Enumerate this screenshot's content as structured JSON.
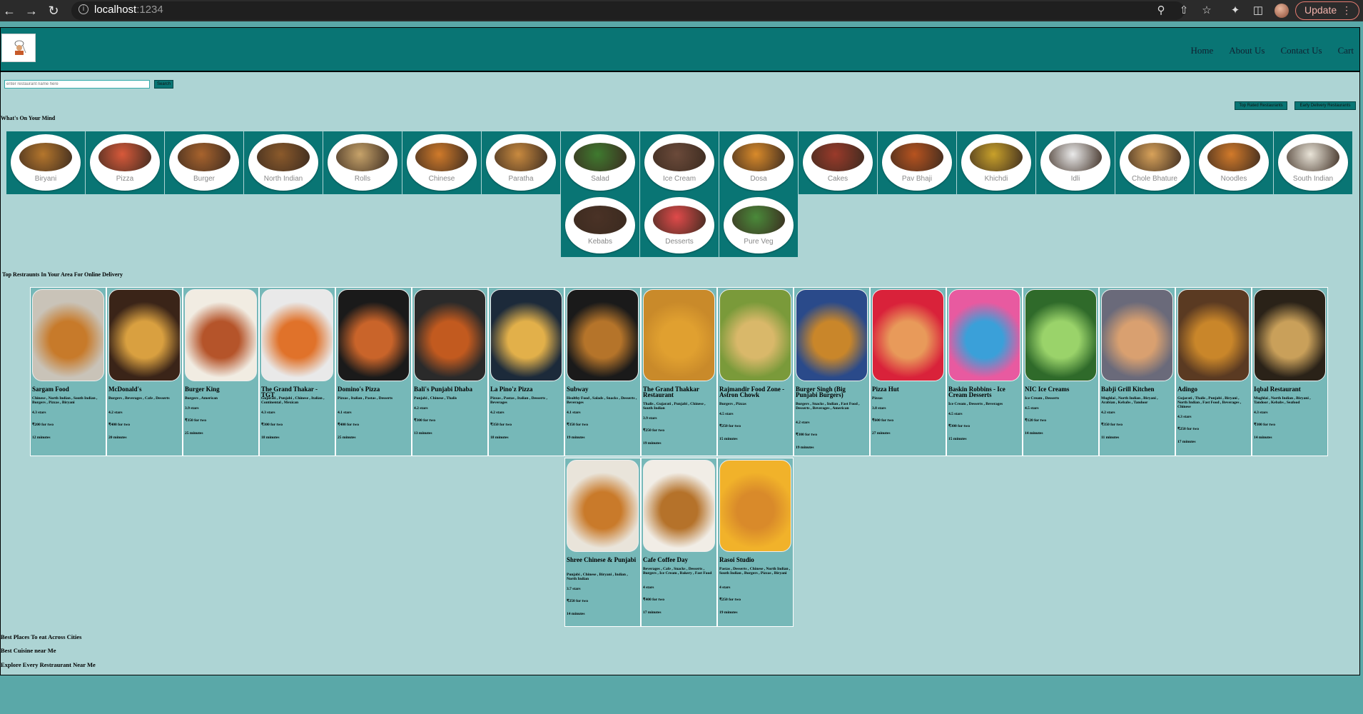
{
  "browser": {
    "url_host": "localhost",
    "url_port": ":1234",
    "update_label": "Update"
  },
  "nav": {
    "links": [
      "Home",
      "About Us",
      "Contact Us",
      "Cart"
    ]
  },
  "search": {
    "placeholder": "enter restaurant name here",
    "button": "Search"
  },
  "filters": [
    "Top Rated Restaurants",
    "Early Delivery Restaurants"
  ],
  "sections": {
    "mind": "What's On Your Mind",
    "top": "Top Restraunts In Your Area For Online Delivery"
  },
  "categories": [
    {
      "name": "Biryani",
      "color": "#b5762c"
    },
    {
      "name": "Pizza",
      "color": "#d8593a"
    },
    {
      "name": "Burger",
      "color": "#a8632d"
    },
    {
      "name": "North Indian",
      "color": "#8b5a2b"
    },
    {
      "name": "Rolls",
      "color": "#c7a36a"
    },
    {
      "name": "Chinese",
      "color": "#d07a2a"
    },
    {
      "name": "Paratha",
      "color": "#c98a3f"
    },
    {
      "name": "Salad",
      "color": "#3f7a2f"
    },
    {
      "name": "Ice Cream",
      "color": "#6b4a3a"
    },
    {
      "name": "Dosa",
      "color": "#d98a2a"
    },
    {
      "name": "Cakes",
      "color": "#9a3a2a"
    },
    {
      "name": "Pav Bhaji",
      "color": "#b7531f"
    },
    {
      "name": "Khichdi",
      "color": "#c9a12a"
    },
    {
      "name": "Idli",
      "color": "#eaeaea"
    },
    {
      "name": "Chole Bhature",
      "color": "#d8a25a"
    },
    {
      "name": "Noodles",
      "color": "#d27a2a"
    },
    {
      "name": "South Indian",
      "color": "#e9e4d8"
    },
    {
      "name": "Kebabs",
      "color": "#4a3226"
    },
    {
      "name": "Desserts",
      "color": "#e04a4a"
    },
    {
      "name": "Pure Veg",
      "color": "#4a8a3a"
    }
  ],
  "restaurants": [
    {
      "name": "Sargam Food",
      "cuisine": "Chinese , North Indian , South Indian , Burgers , Pizzas , Biryani",
      "rating": "4.3 stars",
      "cost": "₹200 for two",
      "time": "12 minutes",
      "bg": "#c9c3b8",
      "accent": "#c77a2a"
    },
    {
      "name": "McDonald's",
      "cuisine": "Burgers , Beverages , Cafe , Desserts",
      "rating": "4.2 stars",
      "cost": "₹400 for two",
      "time": "20 minutes",
      "bg": "#3a2418",
      "accent": "#d9a040"
    },
    {
      "name": "Burger King",
      "cuisine": "Burgers , American",
      "rating": "3.9 stars",
      "cost": "₹350 for two",
      "time": "25 minutes",
      "bg": "#f1ece2",
      "accent": "#b5542a"
    },
    {
      "name": "The Grand Thakar - TGT",
      "cuisine": "Gujarati , Punjabi , Chinese , Italian , Continental , Mexican",
      "rating": "4.3 stars",
      "cost": "₹300 for two",
      "time": "18 minutes",
      "bg": "#e9e9e9",
      "accent": "#e0722a"
    },
    {
      "name": "Domino's Pizza",
      "cuisine": "Pizzas , Italian , Pastas , Desserts",
      "rating": "4.1 stars",
      "cost": "₹400 for two",
      "time": "25 minutes",
      "bg": "#1a1a1a",
      "accent": "#c9642a"
    },
    {
      "name": "Bali's Punjabi Dhaba",
      "cuisine": "Punjabi , Chinese , Thalis",
      "rating": "4.2 stars",
      "cost": "₹300 for two",
      "time": "13 minutes",
      "bg": "#2a2a2a",
      "accent": "#c25a1f"
    },
    {
      "name": "La Pino'z Pizza",
      "cuisine": "Pizzas , Pastas , Italian , Desserts , Beverages",
      "rating": "4.2 stars",
      "cost": "₹350 for two",
      "time": "18 minutes",
      "bg": "#1c2a3a",
      "accent": "#e2b04a"
    },
    {
      "name": "Subway",
      "cuisine": "Healthy Food , Salads , Snacks , Desserts , Beverages",
      "rating": "4.1 stars",
      "cost": "₹350 for two",
      "time": "19 minutes",
      "bg": "#1a1a1a",
      "accent": "#b5742a"
    },
    {
      "name": "The Grand Thakkar Restaurant",
      "cuisine": "Thalis , Gujarati , Punjabi , Chinese , South Indian",
      "rating": "3.9 stars",
      "cost": "₹250 for two",
      "time": "19 minutes",
      "bg": "#c98a2a",
      "accent": "#e0a030"
    },
    {
      "name": "Rajmandir Food Zone - Astron Chowk",
      "cuisine": "Burgers , Pizzas",
      "rating": "4.5 stars",
      "cost": "₹250 for two",
      "time": "15 minutes",
      "bg": "#7a9a3a",
      "accent": "#d9b86a"
    },
    {
      "name": "Burger Singh (Big Punjabi Burgers)",
      "cuisine": "Burgers , Snacks , Indian , Fast Food , Desserts , Beverages , American",
      "rating": "4.2 stars",
      "cost": "₹300 for two",
      "time": "19 minutes",
      "bg": "#2a4a8a",
      "accent": "#c9862a"
    },
    {
      "name": "Pizza Hut",
      "cuisine": "Pizzas",
      "rating": "3.8 stars",
      "cost": "₹600 for two",
      "time": "27 minutes",
      "bg": "#d9223a",
      "accent": "#e89a5a"
    },
    {
      "name": "Baskin Robbins - Ice Cream Desserts",
      "cuisine": "Ice Cream , Desserts , Beverages",
      "rating": "4.5 stars",
      "cost": "₹300 for two",
      "time": "15 minutes",
      "bg": "#e85aa0",
      "accent": "#3aa0d9"
    },
    {
      "name": "NIC Ice Creams",
      "cuisine": "Ice Cream , Desserts",
      "rating": "4.5 stars",
      "cost": "₹120 for two",
      "time": "14 minutes",
      "bg": "#2f6a2a",
      "accent": "#9ad36a"
    },
    {
      "name": "Babji Grill Kitchen",
      "cuisine": "Mughlai , North Indian , Biryani , Arabian , Kebabs , Tandoor",
      "rating": "4.2 stars",
      "cost": "₹350 for two",
      "time": "11 minutes",
      "bg": "#6a6a7a",
      "accent": "#d9a070"
    },
    {
      "name": "Adingo",
      "cuisine": "Gujarati , Thalis , Punjabi , Biryani , North Indian , Fast Food , Beverages , Chinese",
      "rating": "4.3 stars",
      "cost": "₹250 for two",
      "time": "17 minutes",
      "bg": "#5a3a22",
      "accent": "#c9862a"
    },
    {
      "name": "Iqbal Restaurant",
      "cuisine": "Mughlai , North Indian , Biryani , Tandoor , Kebabs , Seafood",
      "rating": "4.3 stars",
      "cost": "₹300 for two",
      "time": "14 minutes",
      "bg": "#2a2218",
      "accent": "#c9a05a"
    },
    {
      "name": "Shree Chinese & Punjabi",
      "cuisine": "Punjabi , Chinese , Biryani , Indian , North Indian",
      "rating": "3.7 stars",
      "cost": "₹250 for two",
      "time": "14 minutes",
      "bg": "#e9e4da",
      "accent": "#c97a2a"
    },
    {
      "name": "Cafe Coffee Day",
      "cuisine": "Beverages , Cafe , Snacks , Desserts , Burgers , Ice Cream , Bakery , Fast Food",
      "rating": "4 stars",
      "cost": "₹400 for two",
      "time": "17 minutes",
      "bg": "#f1ede6",
      "accent": "#b5722a"
    },
    {
      "name": "Rasoi Studio",
      "cuisine": "Pastas , Desserts , Chinese , North Indian , South Indian , Burgers , Pizzas , Biryani",
      "rating": "4 stars",
      "cost": "₹250 for two",
      "time": "19 minutes",
      "bg": "#f1b22a",
      "accent": "#d98a2a"
    }
  ],
  "footer_links": [
    "Best Places To eat Across Cities",
    "Best Cuisine near Me",
    "Explore Every Restraurant Near Me"
  ]
}
